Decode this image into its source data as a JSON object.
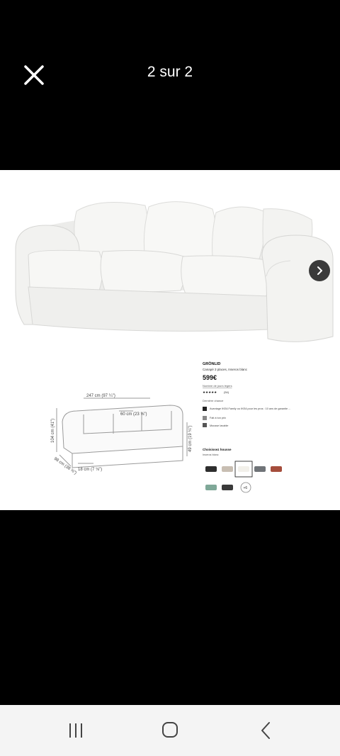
{
  "viewer": {
    "counter": "2 sur 2",
    "close_icon": "close-icon",
    "next_icon": "chevron-right-icon"
  },
  "product": {
    "name": "GRÖNLID",
    "description": "Canapé 3 places, Inseros blanc",
    "price": "599€",
    "rating_count": "(54)",
    "stars": "★★★★★",
    "link_text": "Nombre de jours légers",
    "section_label": "Dernière chance",
    "benefits": [
      "Avantage IKEA Family ou IKEA pour les pros : 10 ans de garantie ...",
      "Fait à ton prix",
      "Mousse lavable"
    ],
    "cover_heading": "Choisissez housse",
    "cover_selected": "Inseros blanc",
    "more_swatches": "+6",
    "swatch_colors": [
      "#2e2e2e",
      "#c8beb2",
      "#f2f0ea",
      "#707478",
      "#a54d3c",
      "#7fa898",
      "#3a3a3a"
    ]
  },
  "dimensions": {
    "width": "247 cm (97 ¼\")",
    "seat_depth": "60 cm (23 ⅝\")",
    "height": "104 cm (41\")",
    "depth": "98 cm (38 ⅝\")",
    "leg": "18 cm (7 ⅛\")",
    "seat_height": "49 cm (19 ¼\")"
  },
  "navbar": {
    "recent_icon": "recent-apps-icon",
    "home_icon": "home-icon",
    "back_icon": "back-icon"
  }
}
